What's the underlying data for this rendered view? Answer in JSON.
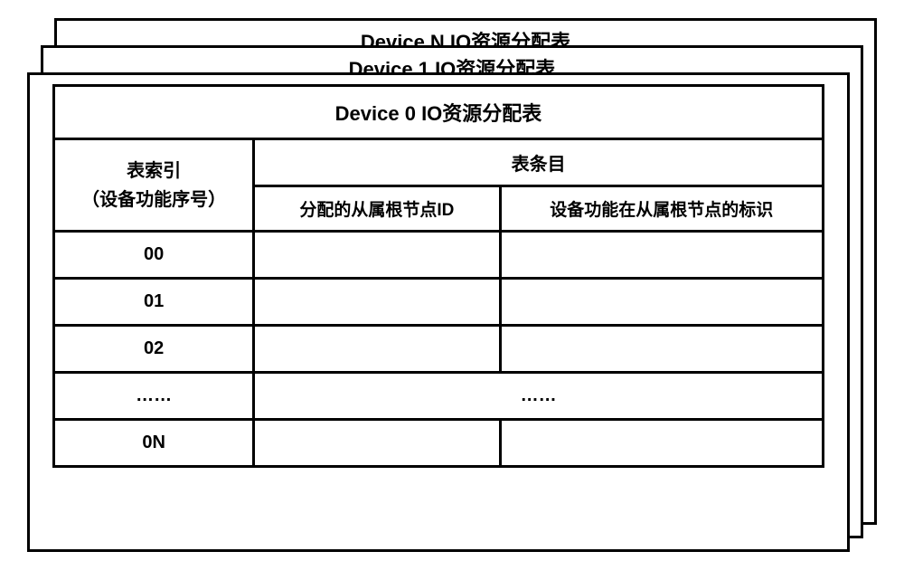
{
  "cards": {
    "n": {
      "title": "Device N IO资源分配表"
    },
    "1": {
      "title": "Device 1 IO资源分配表"
    },
    "0": {
      "title": "Device 0 IO资源分配表"
    }
  },
  "table": {
    "indexHeader": "表索引",
    "indexSubHeader": "（设备功能序号）",
    "entryHeader": "表条目",
    "entryCol1": "分配的从属根节点ID",
    "entryCol2": "设备功能在从属根节点的标识",
    "rows": [
      {
        "index": "00",
        "col1": "",
        "col2": ""
      },
      {
        "index": "01",
        "col1": "",
        "col2": ""
      },
      {
        "index": "02",
        "col1": "",
        "col2": ""
      },
      {
        "index": "……",
        "col1": "",
        "col2": "……"
      },
      {
        "index": "0N",
        "col1": "",
        "col2": ""
      }
    ]
  }
}
